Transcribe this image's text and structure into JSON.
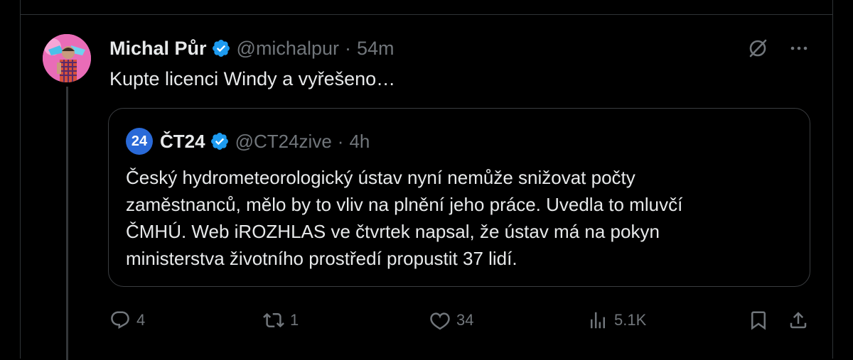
{
  "tweet": {
    "author_name": "Michal Půr",
    "handle": "@michalpur",
    "separator": "·",
    "time": "54m",
    "text": "Kupte licenci Windy a vyřešeno…"
  },
  "quote": {
    "logo_text": "24",
    "author_name": "ČT24",
    "handle": "@CT24zive",
    "separator": "·",
    "time": "4h",
    "lines": [
      "Český hydrometeorologický ústav nyní nemůže snižovat počty",
      "zaměstnanců, mělo by to vliv na plnění jeho práce. Uvedla to mluvčí",
      "ČMHÚ. Web iROZHLAS ve čtvrtek napsal, že ústav má na pokyn",
      "ministerstva životního prostředí propustit 37 lidí."
    ]
  },
  "actions": {
    "replies": "4",
    "reposts": "1",
    "likes": "34",
    "views": "5.1K"
  },
  "colors": {
    "background": "#000000",
    "text": "#e7e9ea",
    "muted": "#71767b",
    "verified": "#1d9bf0",
    "border": "#2f3336",
    "ct24_logo": "#2a6ad8"
  },
  "icons": [
    "verified-badge-icon",
    "grok-icon",
    "more-icon",
    "reply-icon",
    "repost-icon",
    "like-icon",
    "views-icon",
    "bookmark-icon",
    "share-icon"
  ]
}
